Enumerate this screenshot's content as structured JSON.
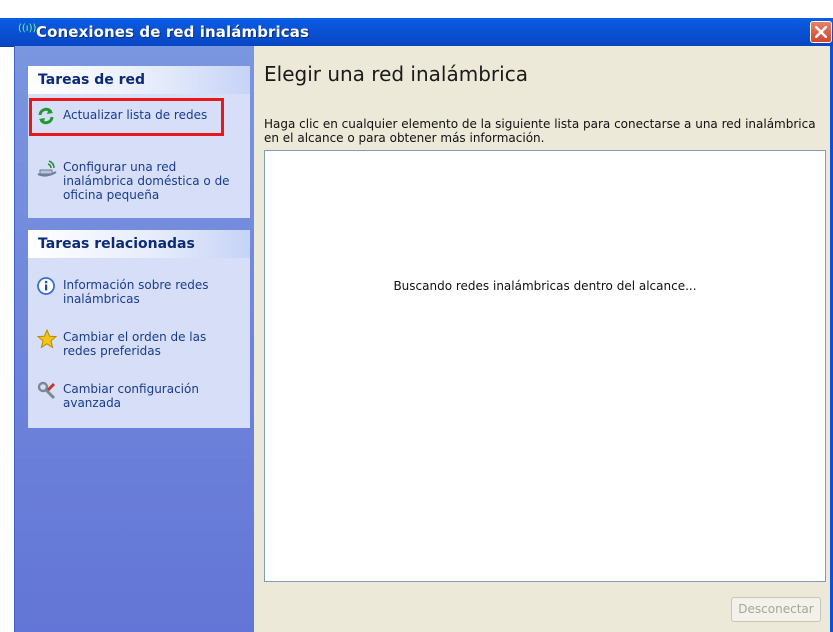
{
  "window": {
    "title": "Conexiones de red inalámbricas",
    "title_icon_glyph": "((ı))"
  },
  "sidebar": {
    "network_tasks": {
      "header": "Tareas de red",
      "items": [
        {
          "label": "Actualizar lista de redes",
          "icon": "refresh-icon"
        },
        {
          "label": "Configurar una red inalámbrica doméstica o de oficina pequeña",
          "icon": "setup-network-icon"
        }
      ]
    },
    "related_tasks": {
      "header": "Tareas relacionadas",
      "items": [
        {
          "label": "Información sobre redes inalámbricas",
          "icon": "info-icon"
        },
        {
          "label": "Cambiar el orden de las redes preferidas",
          "icon": "star-icon"
        },
        {
          "label": "Cambiar configuración avanzada",
          "icon": "tools-icon"
        }
      ]
    }
  },
  "main": {
    "title": "Elegir una red inalámbrica",
    "description": "Haga clic en cualquier elemento de la siguiente lista para conectarse a una red inalámbrica en el alcance o para obtener más información.",
    "status": "Buscando redes inalámbricas dentro del alcance...",
    "disconnect_label": "Desconectar"
  },
  "colors": {
    "titlebar": "#0a52d6",
    "sidebar": "#6f86da",
    "highlight": "#e81818"
  }
}
